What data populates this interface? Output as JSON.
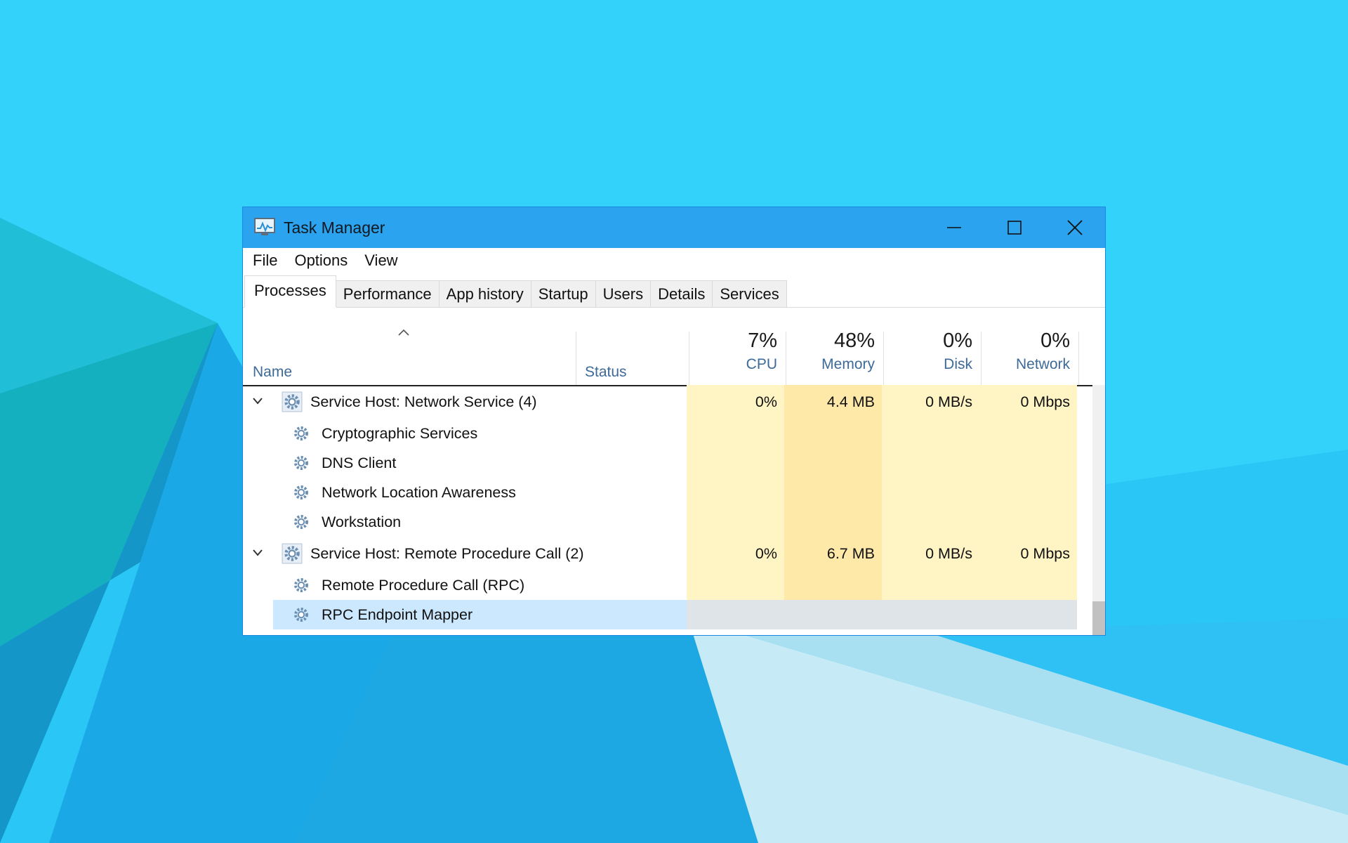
{
  "window": {
    "title": "Task Manager",
    "controls": {
      "minimize": "minimize-icon",
      "maximize": "maximize-icon",
      "close": "close-icon"
    }
  },
  "menu": [
    "File",
    "Options",
    "View"
  ],
  "tabs": [
    "Processes",
    "Performance",
    "App history",
    "Startup",
    "Users",
    "Details",
    "Services"
  ],
  "active_tab": "Processes",
  "columns": {
    "name": "Name",
    "status": "Status",
    "cpu": {
      "percent": "7%",
      "label": "CPU"
    },
    "memory": {
      "percent": "48%",
      "label": "Memory"
    },
    "disk": {
      "percent": "0%",
      "label": "Disk"
    },
    "network": {
      "percent": "0%",
      "label": "Network"
    }
  },
  "rows": [
    {
      "type": "group",
      "name": "Service Host: Network Service (4)",
      "cpu": "0%",
      "memory": "4.4 MB",
      "disk": "0 MB/s",
      "network": "0 Mbps"
    },
    {
      "type": "child",
      "name": "Cryptographic Services"
    },
    {
      "type": "child",
      "name": "DNS Client"
    },
    {
      "type": "child",
      "name": "Network Location Awareness"
    },
    {
      "type": "child",
      "name": "Workstation"
    },
    {
      "type": "group",
      "name": "Service Host: Remote Procedure Call (2)",
      "cpu": "0%",
      "memory": "6.7 MB",
      "disk": "0 MB/s",
      "network": "0 Mbps"
    },
    {
      "type": "child",
      "name": "Remote Procedure Call (RPC)"
    },
    {
      "type": "child",
      "name": "RPC Endpoint Mapper",
      "selected": true
    }
  ],
  "colors": {
    "titlebar": "#2ba3ee",
    "cpu_fill": "#fff4c4",
    "memory_fill": "#ffe9a8",
    "selection": "#cce8ff"
  }
}
